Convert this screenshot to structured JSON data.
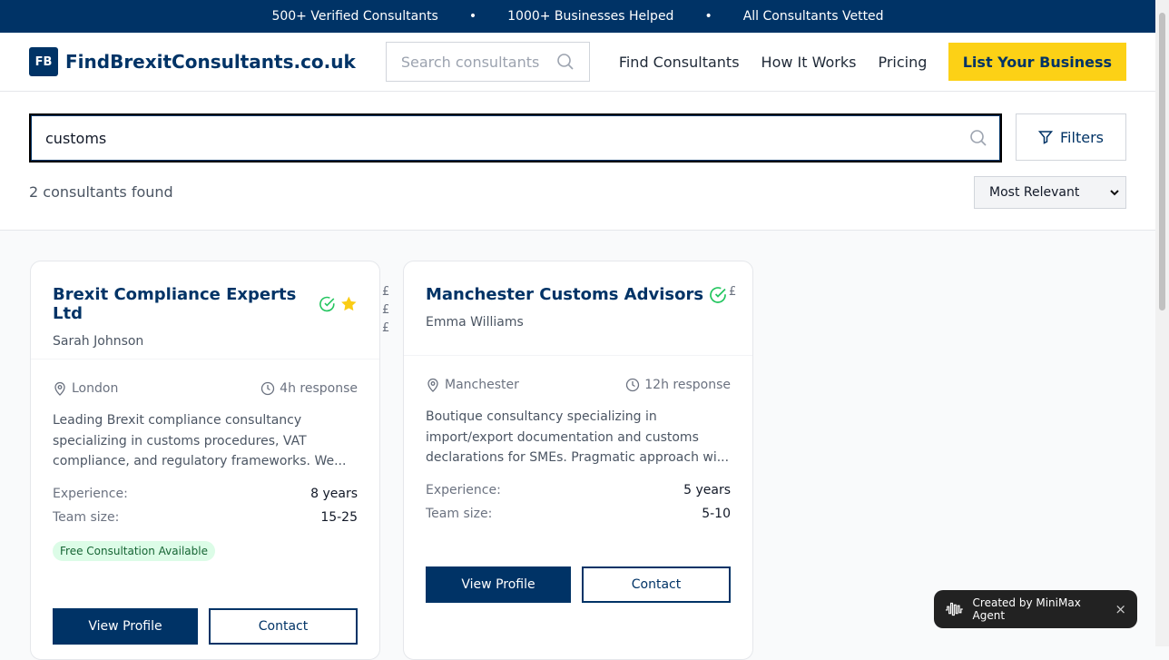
{
  "topbar": {
    "items": [
      "500+ Verified Consultants",
      "1000+ Businesses Helped",
      "All Consultants Vetted"
    ],
    "separator": "•"
  },
  "header": {
    "logo_mark": "FB",
    "logo_text": "FindBrexitConsultants.co.uk",
    "search_placeholder": "Search consultants",
    "nav": [
      "Find Consultants",
      "How It Works",
      "Pricing"
    ],
    "cta": "List Your Business"
  },
  "search": {
    "value": "customs",
    "filters_label": "Filters",
    "results_count": "2 consultants found",
    "sort_selected": "Most Relevant"
  },
  "consultants": [
    {
      "name": "Brexit Compliance Experts Ltd",
      "contact": "Sarah Johnson",
      "verified": true,
      "featured": true,
      "price": "£££",
      "location": "London",
      "response": "4h response",
      "description": "Leading Brexit compliance consultancy specializing in customs procedures, VAT compliance, and regulatory frameworks. We...",
      "experience_label": "Experience:",
      "experience": "8 years",
      "team_label": "Team size:",
      "team": "15-25",
      "badge": "Free Consultation Available",
      "view_label": "View Profile",
      "contact_label": "Contact"
    },
    {
      "name": "Manchester Customs Advisors",
      "contact": "Emma Williams",
      "verified": true,
      "featured": false,
      "price": "£",
      "location": "Manchester",
      "response": "12h response",
      "description": "Boutique consultancy specializing in import/export documentation and customs declarations for SMEs. Pragmatic approach wi...",
      "experience_label": "Experience:",
      "experience": "5 years",
      "team_label": "Team size:",
      "team": "5-10",
      "view_label": "View Profile",
      "contact_label": "Contact"
    }
  ],
  "toast": {
    "text": "Created by MiniMax Agent",
    "close": "×"
  },
  "colors": {
    "brand": "#003366",
    "accent": "#fcd116",
    "verified": "#22c55e"
  }
}
